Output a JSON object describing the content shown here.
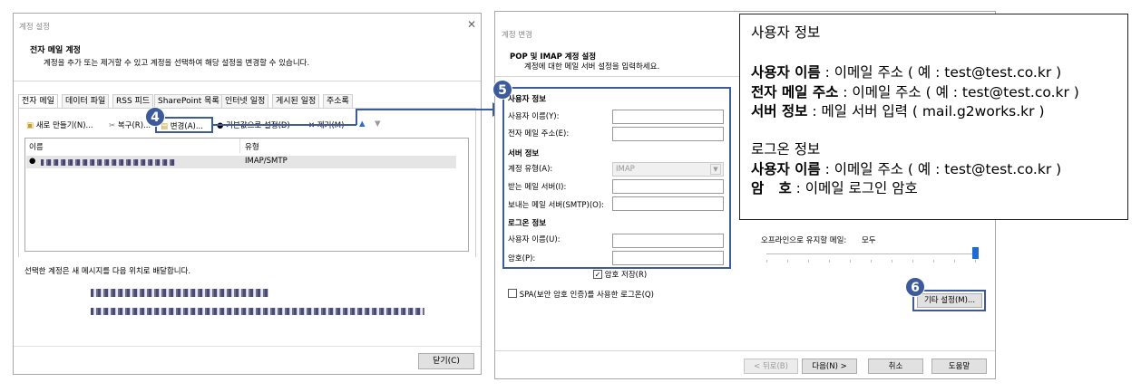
{
  "left_dialog": {
    "title": "계정 설정",
    "header": "전자 메일 계정",
    "description": "계정을 추가 또는 제거할 수 있고 계정을 선택하여 해당 설정을 변경할 수 있습니다.",
    "tabs": [
      "전자 메일",
      "데이터 파일",
      "RSS 피드",
      "SharePoint 목록",
      "인터넷 일정",
      "게시된 일정",
      "주소록"
    ],
    "toolbar": {
      "new": "새로 만들기(N)...",
      "repair": "복구(R)...",
      "change": "변경(A)...",
      "set_default": "기본값으로 설정(D)",
      "remove": "제거(M)"
    },
    "table": {
      "col_name": "이름",
      "col_type": "유형",
      "row_type": "IMAP/SMTP"
    },
    "delivery_text": "선택한 계정은 새 메시지를 다음 위치로 배달합니다.",
    "close_button": "닫기(C)"
  },
  "right_dialog": {
    "title": "계정 변경",
    "header": "POP 및 IMAP 계정 설정",
    "subheader": "계정에 대한 메일 서버 설정을 입력하세요.",
    "user_info_section": "사용자 정보",
    "user_name_label": "사용자 이름(Y):",
    "email_label": "전자 메일 주소(E):",
    "server_section": "서버 정보",
    "account_type_label": "계정 유형(A):",
    "account_type_value": "IMAP",
    "incoming_label": "받는 메일 서버(I):",
    "outgoing_label": "보내는 메일 서버(SMTP)(O):",
    "logon_section": "로그온 정보",
    "logon_user_label": "사용자 이름(U):",
    "password_label": "암호(P):",
    "save_password": "암호 저장(R)",
    "spa": "SPA(보안 암호 인증)를 사용한 로그온(Q)",
    "offline_label": "오프라인으로 유지할 메일:",
    "offline_value": "모두",
    "more_settings": "기타 설정(M)...",
    "back": "< 뒤로(B)",
    "next": "다음(N) >",
    "cancel": "취소",
    "help": "도움말"
  },
  "badges": {
    "four": "4",
    "five": "5",
    "six": "6"
  },
  "info_box": {
    "title": "사용자 정보",
    "l1_bold": "사용자 이름",
    "l1_rest": " : 이메일 주소 ( 예 : test@test.co.kr )",
    "l2_bold": "전자 메일 주소",
    "l2_rest": " : 이메일 주소 ( 예 : test@test.co.kr )",
    "l3_bold": "서버 정보",
    "l3_rest": " : 메일 서버 입력 ( mail.g2works.kr )",
    "logon_title": "로그온 정보",
    "l4_bold": "사용자 이름",
    "l4_rest": " : 이메일 주소 ( 예 : test@test.co.kr )",
    "l5_bold": "암   호",
    "l5_rest": " : 이메일 로그인 암호"
  },
  "colors": {
    "accent": "#3d5b9a",
    "badge": "#3d5b9a"
  }
}
